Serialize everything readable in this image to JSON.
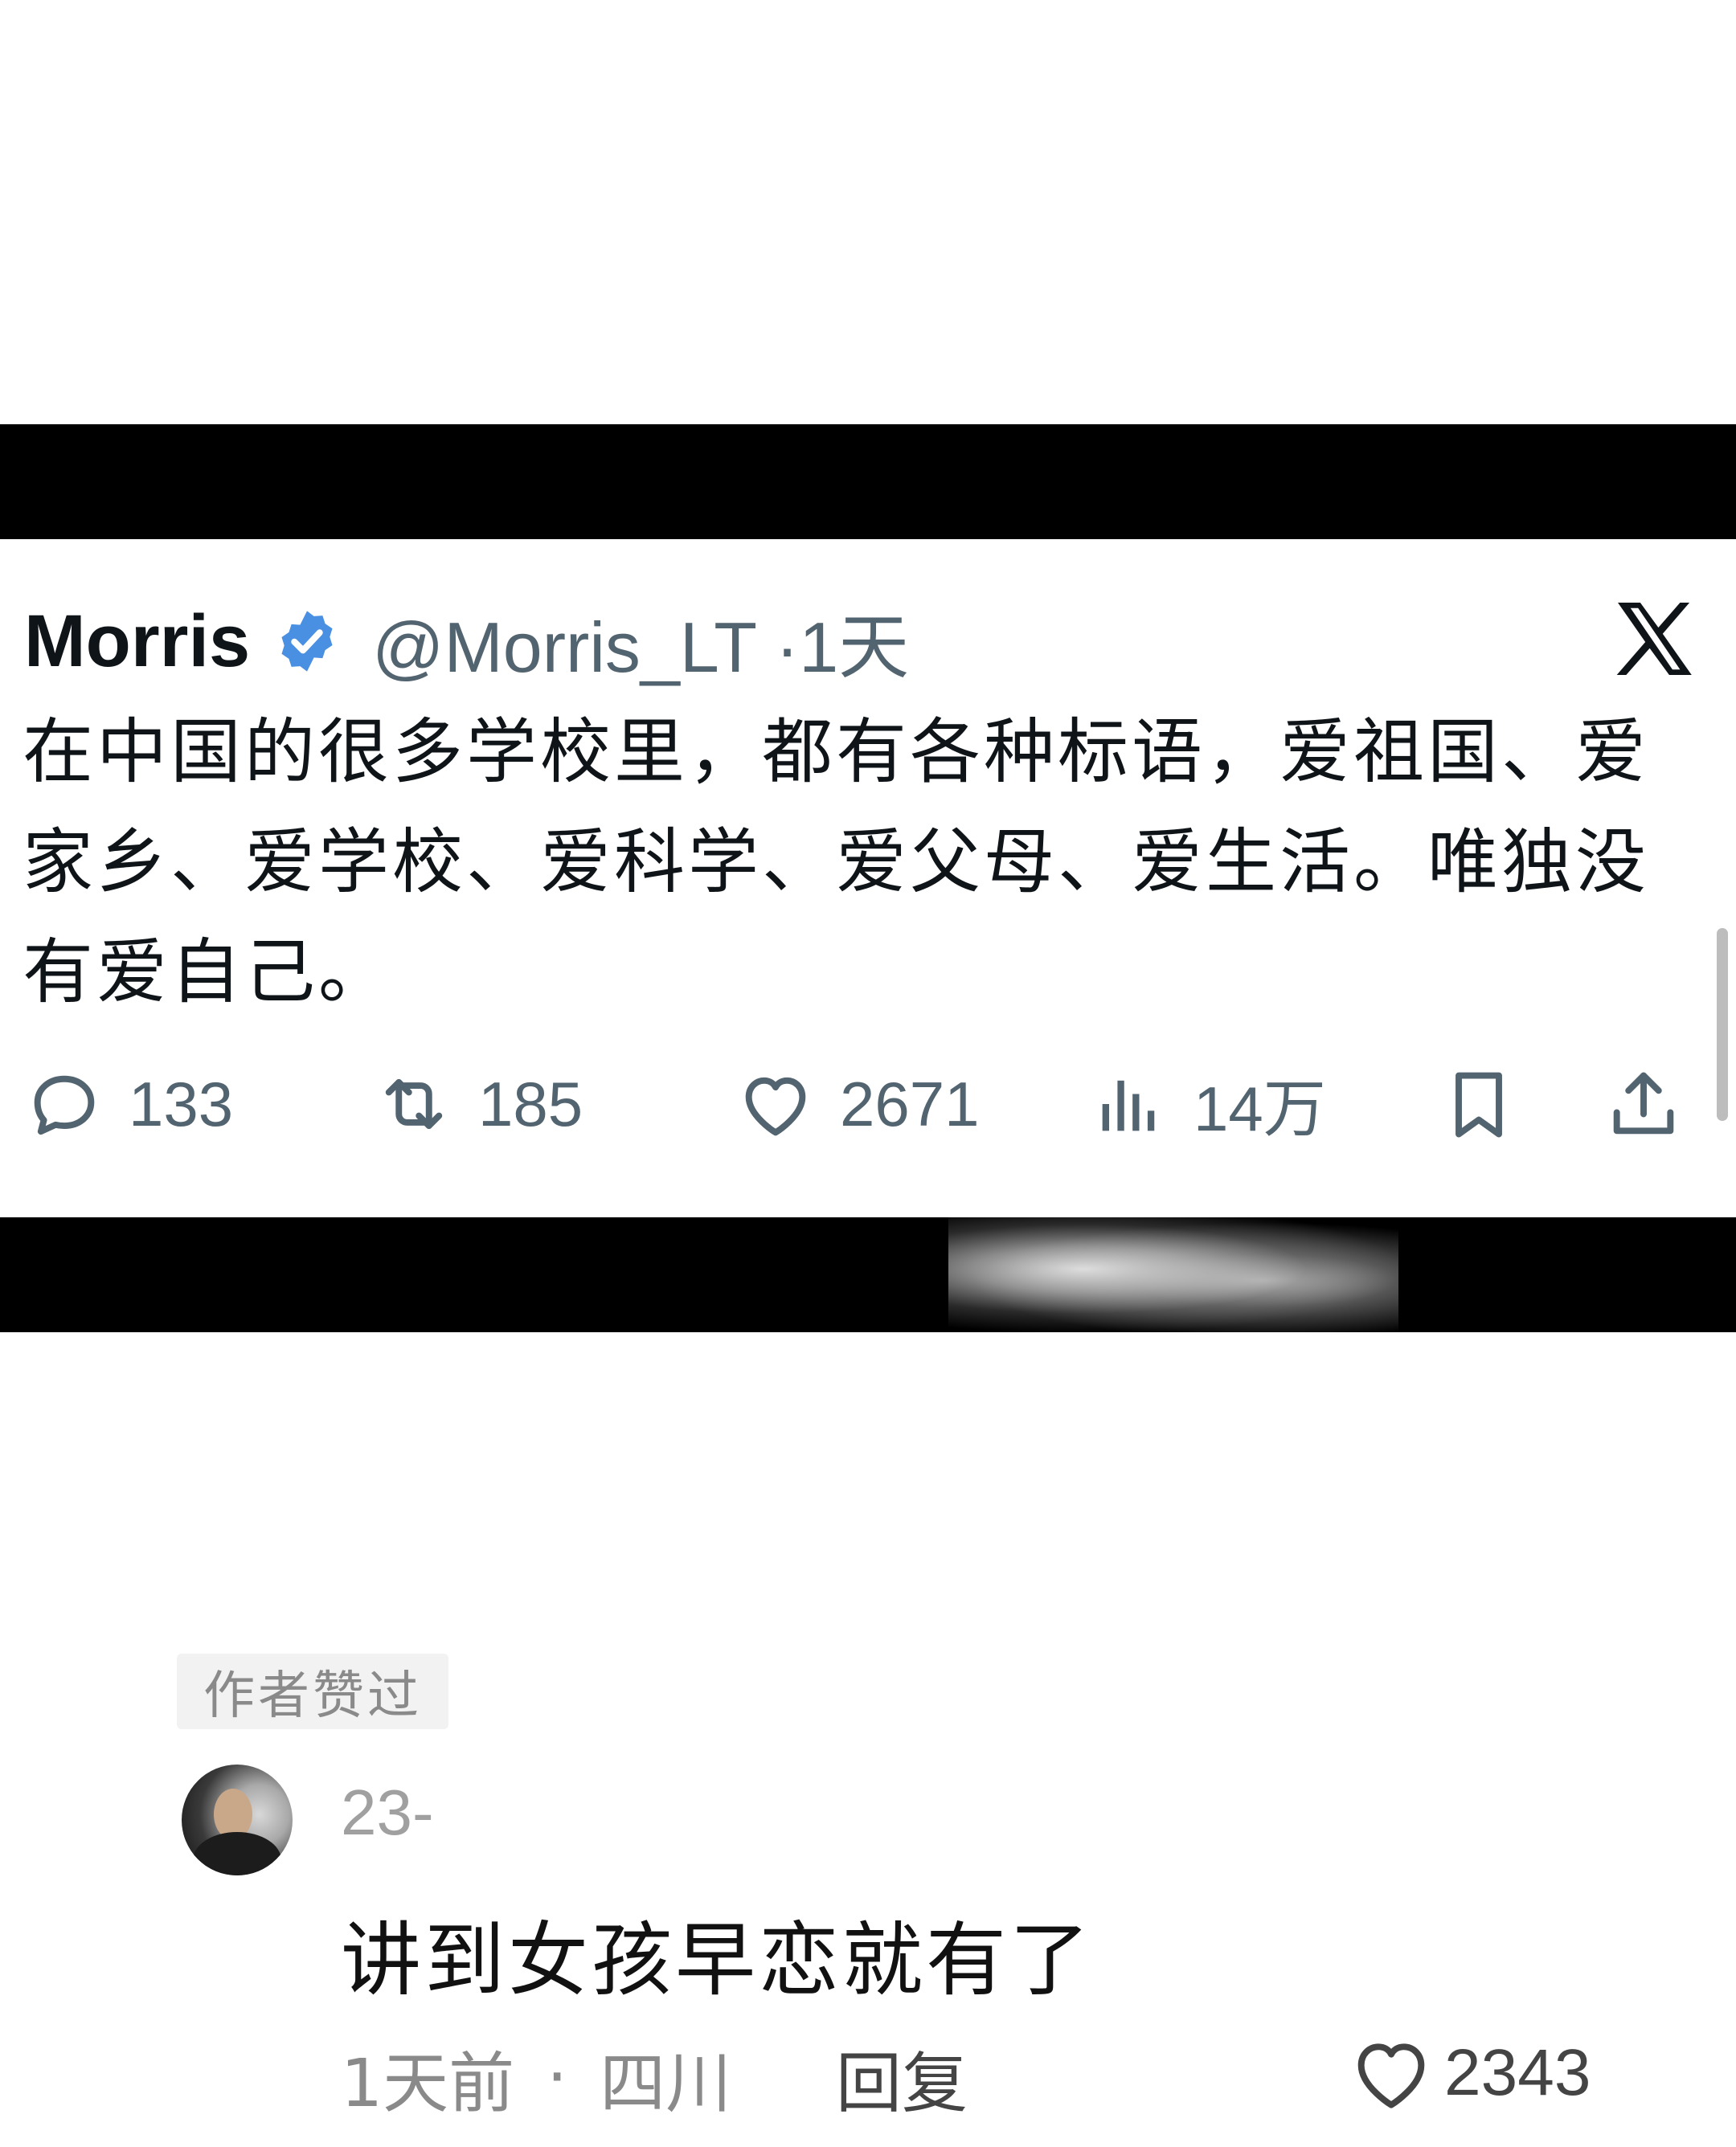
{
  "tweet": {
    "author": "Morris",
    "handle": "@Morris_LT",
    "time": "·1天",
    "text": "在中国的很多学校里，都有各种标语，爱祖国、爱家乡、爱学校、爱科学、爱父母、爱生活。唯独没有爱自己。",
    "replies": "133",
    "retweets": "185",
    "likes": "2671",
    "views": "14万",
    "icons": [
      "verified-badge-icon",
      "x-logo-icon",
      "reply-icon",
      "retweet-icon",
      "heart-icon",
      "views-icon",
      "bookmark-icon",
      "share-icon"
    ]
  },
  "comment": {
    "badge": "作者赞过",
    "username": "23-",
    "text": "讲到女孩早恋就有了",
    "time": "1天前",
    "location": "四川",
    "reply_label": "回复",
    "likes": "2343"
  },
  "colors": {
    "verified": "#4a90e2",
    "secondary_text": "#536471",
    "background": "#ffffff",
    "frame": "#000000"
  }
}
